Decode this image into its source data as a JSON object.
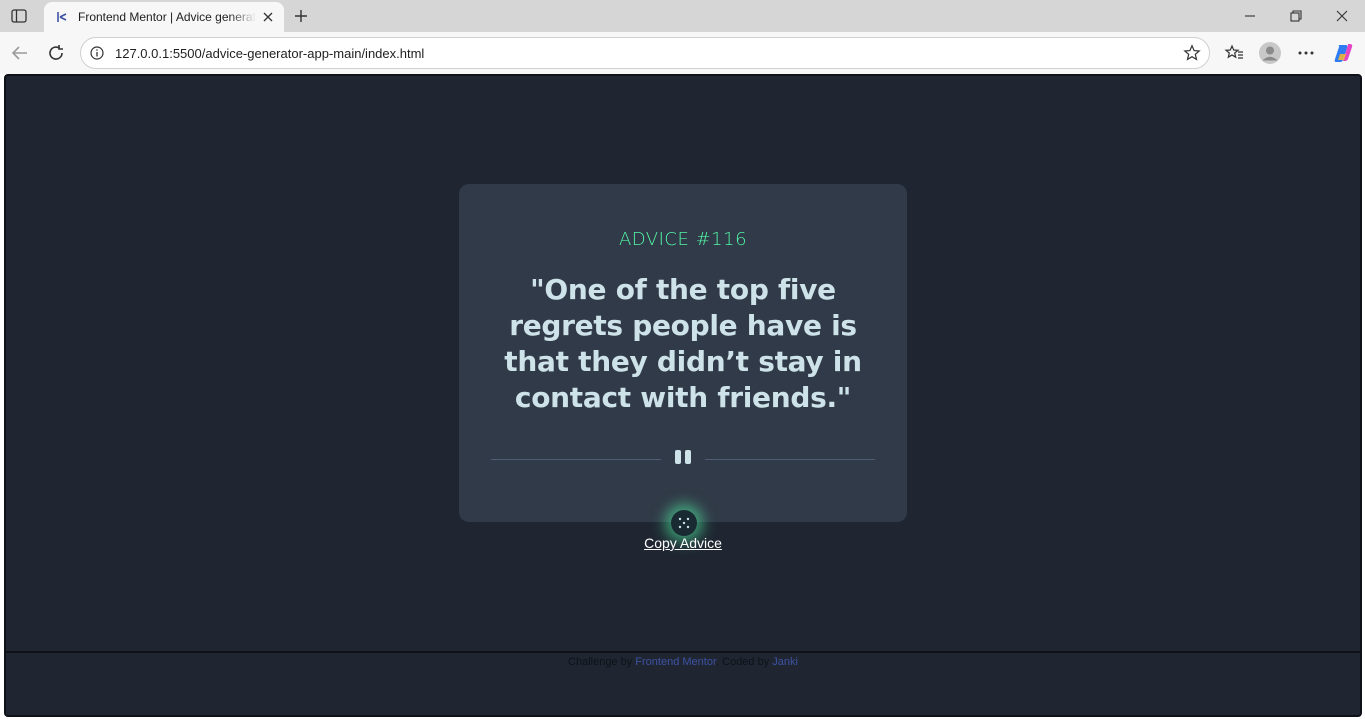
{
  "browser": {
    "tab": {
      "title": "Frontend Mentor | Advice generator app"
    },
    "url": "127.0.0.1:5500/advice-generator-app-main/index.html"
  },
  "page": {
    "advice_id": "ADVICE #116",
    "advice_text": "\"One of the top five regrets people have is that they didn’t stay in contact with friends.\"",
    "copy_label": "Copy Advice",
    "footer": {
      "prefix": "Challenge by ",
      "challenge_link": "Frontend Mentor",
      "middle": ". Coded by ",
      "author_link": "Janki"
    }
  },
  "colors": {
    "page_bg": "#1f2632",
    "card_bg": "#313a48",
    "accent": "#53ffaa",
    "text": "#cee3e9"
  }
}
